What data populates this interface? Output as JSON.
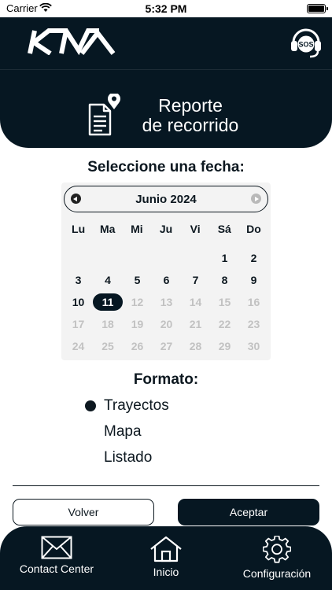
{
  "status_bar": {
    "carrier": "Carrier",
    "time": "5:32 PM"
  },
  "header": {
    "brand_icon": "kia-logo",
    "sos_label": "SOS"
  },
  "title": {
    "line1": "Reporte",
    "line2": "de recorrido",
    "icon": "document-location-icon"
  },
  "date_section": {
    "heading": "Seleccione una fecha:"
  },
  "calendar": {
    "month_label": "Junio 2024",
    "weekdays": [
      "Lu",
      "Ma",
      "Mi",
      "Ju",
      "Vi",
      "Sá",
      "Do"
    ],
    "selected_day": "11",
    "days": [
      {
        "d": "",
        "s": "empty"
      },
      {
        "d": "",
        "s": "empty"
      },
      {
        "d": "",
        "s": "empty"
      },
      {
        "d": "",
        "s": "empty"
      },
      {
        "d": "",
        "s": "empty"
      },
      {
        "d": "1",
        "s": "enabled"
      },
      {
        "d": "2",
        "s": "enabled"
      },
      {
        "d": "3",
        "s": "enabled"
      },
      {
        "d": "4",
        "s": "enabled"
      },
      {
        "d": "5",
        "s": "enabled"
      },
      {
        "d": "6",
        "s": "enabled"
      },
      {
        "d": "7",
        "s": "enabled"
      },
      {
        "d": "8",
        "s": "enabled"
      },
      {
        "d": "9",
        "s": "enabled"
      },
      {
        "d": "10",
        "s": "enabled"
      },
      {
        "d": "11",
        "s": "selected"
      },
      {
        "d": "12",
        "s": "disabled"
      },
      {
        "d": "13",
        "s": "disabled"
      },
      {
        "d": "14",
        "s": "disabled"
      },
      {
        "d": "15",
        "s": "disabled"
      },
      {
        "d": "16",
        "s": "disabled"
      },
      {
        "d": "17",
        "s": "disabled"
      },
      {
        "d": "18",
        "s": "disabled"
      },
      {
        "d": "19",
        "s": "disabled"
      },
      {
        "d": "20",
        "s": "disabled"
      },
      {
        "d": "21",
        "s": "disabled"
      },
      {
        "d": "22",
        "s": "disabled"
      },
      {
        "d": "23",
        "s": "disabled"
      },
      {
        "d": "24",
        "s": "disabled"
      },
      {
        "d": "25",
        "s": "disabled"
      },
      {
        "d": "26",
        "s": "disabled"
      },
      {
        "d": "27",
        "s": "disabled"
      },
      {
        "d": "28",
        "s": "disabled"
      },
      {
        "d": "29",
        "s": "disabled"
      },
      {
        "d": "30",
        "s": "disabled"
      }
    ]
  },
  "format": {
    "heading": "Formato:",
    "options": [
      {
        "label": "Trayectos",
        "selected": true
      },
      {
        "label": "Mapa",
        "selected": false
      },
      {
        "label": "Listado",
        "selected": false
      }
    ]
  },
  "actions": {
    "back_label": "Volver",
    "accept_label": "Aceptar"
  },
  "bottom_nav": {
    "items": [
      {
        "label": "Contact Center",
        "icon": "envelope-icon"
      },
      {
        "label": "Inicio",
        "icon": "home-icon"
      },
      {
        "label": "Configuración",
        "icon": "gear-icon"
      }
    ]
  },
  "colors": {
    "primary": "#061722",
    "background": "#ffffff",
    "calendar_bg": "#f3f3f3",
    "disabled_text": "#c2c2c2"
  }
}
